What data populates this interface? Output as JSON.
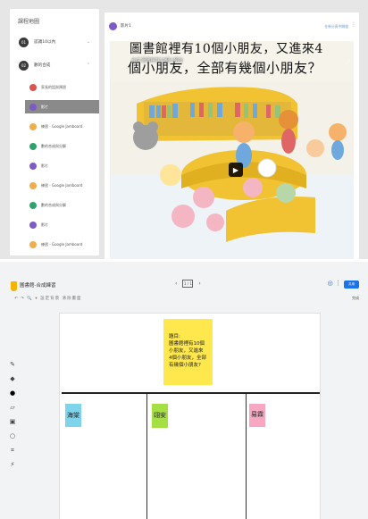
{
  "classroom": {
    "sidebar": {
      "title": "課程地圖",
      "units": [
        {
          "num": "01",
          "label": "認識10以內"
        },
        {
          "num": "02",
          "label": "數的合成"
        }
      ],
      "items": [
        {
          "label": "家長的話與預習",
          "color": "#d9534f"
        },
        {
          "label": "影片",
          "color": "#7b5cc4",
          "active": true
        },
        {
          "label": "練習 - Google Jamboard",
          "color": "#f0ad4e"
        },
        {
          "label": "數的合成與分解",
          "color": "#2ea36d"
        },
        {
          "label": "影片",
          "color": "#7b5cc4"
        },
        {
          "label": "練習 - Google Jamboard",
          "color": "#f0ad4e"
        },
        {
          "label": "數的合成與分解",
          "color": "#2ea36d"
        },
        {
          "label": "影片",
          "color": "#7b5cc4"
        },
        {
          "label": "練習 - Google Jamboard",
          "color": "#f0ad4e"
        },
        {
          "label": "數的合成與分解",
          "color": "#2ea36d"
        }
      ]
    },
    "content": {
      "title": "影片1",
      "link_text": "在新分頁中開啟",
      "video": {
        "channel_title": "合成 圖書館有10個小朋友",
        "caption_line1": "圖書館裡有10個小朋友，又進來4",
        "caption_line2": "個小朋友，全部有幾個小朋友？"
      }
    }
  },
  "jamboard": {
    "title": "圖書館-合成練習",
    "menu": "↶ ↷ 🔍 ▾ 設定背景 清除畫面",
    "frame": {
      "label": "1 / 1"
    },
    "share_label": "共用",
    "right_label": "完成",
    "tools": [
      "pen-icon",
      "eraser-icon",
      "select-icon",
      "sticky-note-icon",
      "image-icon",
      "circle-icon",
      "textbox-icon",
      "laser-icon"
    ],
    "notes": {
      "question": "題目:\n圖書館裡有10個\n小朋友，又進來\n4個小朋友，全部\n有幾個小朋友?",
      "col1": "海棠",
      "col2": "翊安",
      "col3": "易霖"
    }
  }
}
